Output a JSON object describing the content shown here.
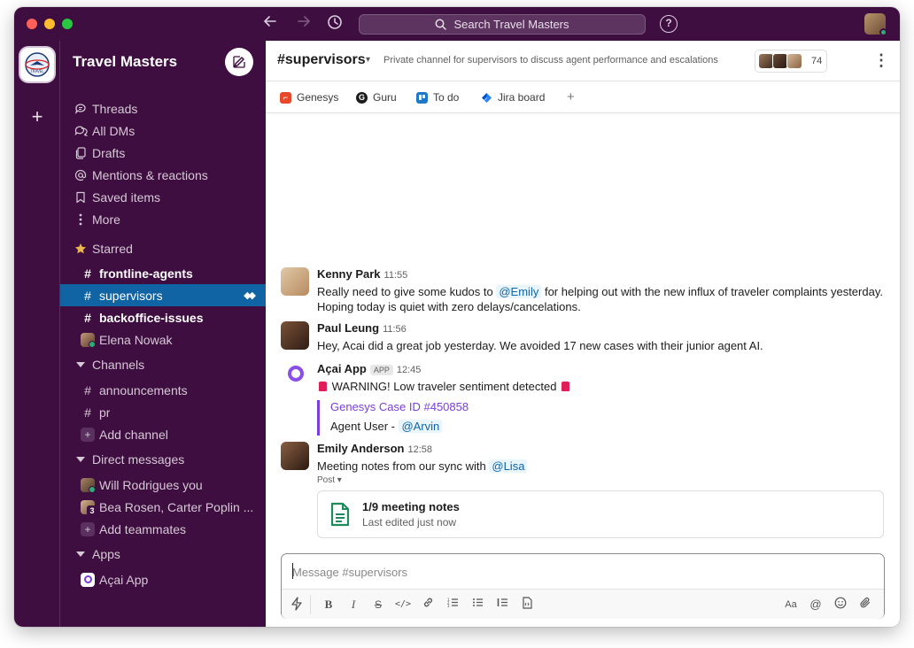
{
  "titlebar": {
    "search_label": "Search Travel Masters",
    "help_label": "?"
  },
  "workspace": {
    "name": "Travel Masters",
    "logo_text": "TRAVEL"
  },
  "sidebar": {
    "nav": [
      {
        "label": "Threads",
        "icon": "threads-icon"
      },
      {
        "label": "All DMs",
        "icon": "dms-icon"
      },
      {
        "label": "Drafts",
        "icon": "drafts-icon"
      },
      {
        "label": "Mentions & reactions",
        "icon": "at-icon"
      },
      {
        "label": "Saved items",
        "icon": "bookmark-icon"
      },
      {
        "label": "More",
        "icon": "more-icon"
      }
    ],
    "starred_label": "Starred",
    "starred": [
      {
        "label": "frontline-agents"
      },
      {
        "label": "supervisors"
      },
      {
        "label": "backoffice-issues"
      },
      {
        "label": "Elena Nowak"
      }
    ],
    "channels_label": "Channels",
    "channels": [
      {
        "label": "announcements"
      },
      {
        "label": "pr"
      }
    ],
    "add_channel": "Add channel",
    "dm_label": "Direct messages",
    "dms": [
      {
        "label": "Will Rodrigues you"
      },
      {
        "label": "Bea Rosen, Carter Poplin ...",
        "badge": "3"
      }
    ],
    "add_teammates": "Add teammates",
    "apps_label": "Apps",
    "apps": [
      {
        "label": "Açai App"
      }
    ]
  },
  "channel": {
    "name": "#supervisors",
    "description": "Private channel for supervisors to discuss agent performance and escalations",
    "member_count": "74"
  },
  "bookmarks": [
    {
      "label": "Genesys",
      "color": "#e8472a"
    },
    {
      "label": "Guru",
      "color": "#1d1c1d",
      "letter": "G"
    },
    {
      "label": "To do",
      "color": "#1e78c8"
    },
    {
      "label": "Jira board",
      "color": "#2684ff"
    }
  ],
  "messages": [
    {
      "author": "Kenny Park",
      "time": "11:55",
      "text_before": "Really need to give some kudos to",
      "mention": "@Emily",
      "text_after": "for helping out with the new influx of traveler complaints yesterday.",
      "line2": "Hoping today is quiet with zero delays/cancelations."
    },
    {
      "author": "Paul Leung",
      "time": "11:56",
      "text": "Hey, Acai did a great job yesterday. We avoided 17 new cases with their junior agent AI."
    },
    {
      "author": "Açai App",
      "tag": "APP",
      "time": "12:45",
      "text": "WARNING! Low traveler sentiment detected",
      "attachment_title": "Genesys Case ID #450858",
      "attachment_line": "Agent User -",
      "attachment_mention": "@Arvin"
    },
    {
      "author": "Emily Anderson",
      "time": "12:58",
      "text": "Meeting notes from our sync with",
      "mention": "@Lisa",
      "post_label": "Post",
      "file_title": "1/9 meeting notes",
      "file_sub": "Last edited just now"
    }
  ],
  "composer": {
    "placeholder": "Message #supervisors",
    "format_label": "Aa"
  },
  "colors": {
    "aubergine": "#3f0e40",
    "active": "#1164a3",
    "mention": "#1264a3",
    "app_purple": "#7a3fd6",
    "online": "#2bac76"
  }
}
